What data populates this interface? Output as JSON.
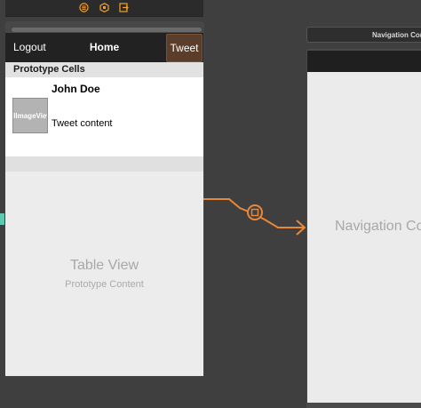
{
  "toolbar": {
    "icons": [
      "view-controller-icon",
      "first-responder-icon",
      "exit-icon"
    ],
    "accent": "#f0a030"
  },
  "scene": {
    "navbar": {
      "left_button": "Logout",
      "title": "Home",
      "right_button": "Tweet"
    },
    "table": {
      "section_header": "Prototype Cells",
      "cell": {
        "image_label": "UIImageView",
        "name": "John Doe",
        "content": "Tweet content"
      },
      "placeholder_title": "Table View",
      "placeholder_subtitle": "Prototype Content"
    }
  },
  "segue": {
    "color": "#e8883a"
  },
  "navigation_controller": {
    "scene_label": "Navigation Controller Scene",
    "title": "Navigation Controller"
  }
}
